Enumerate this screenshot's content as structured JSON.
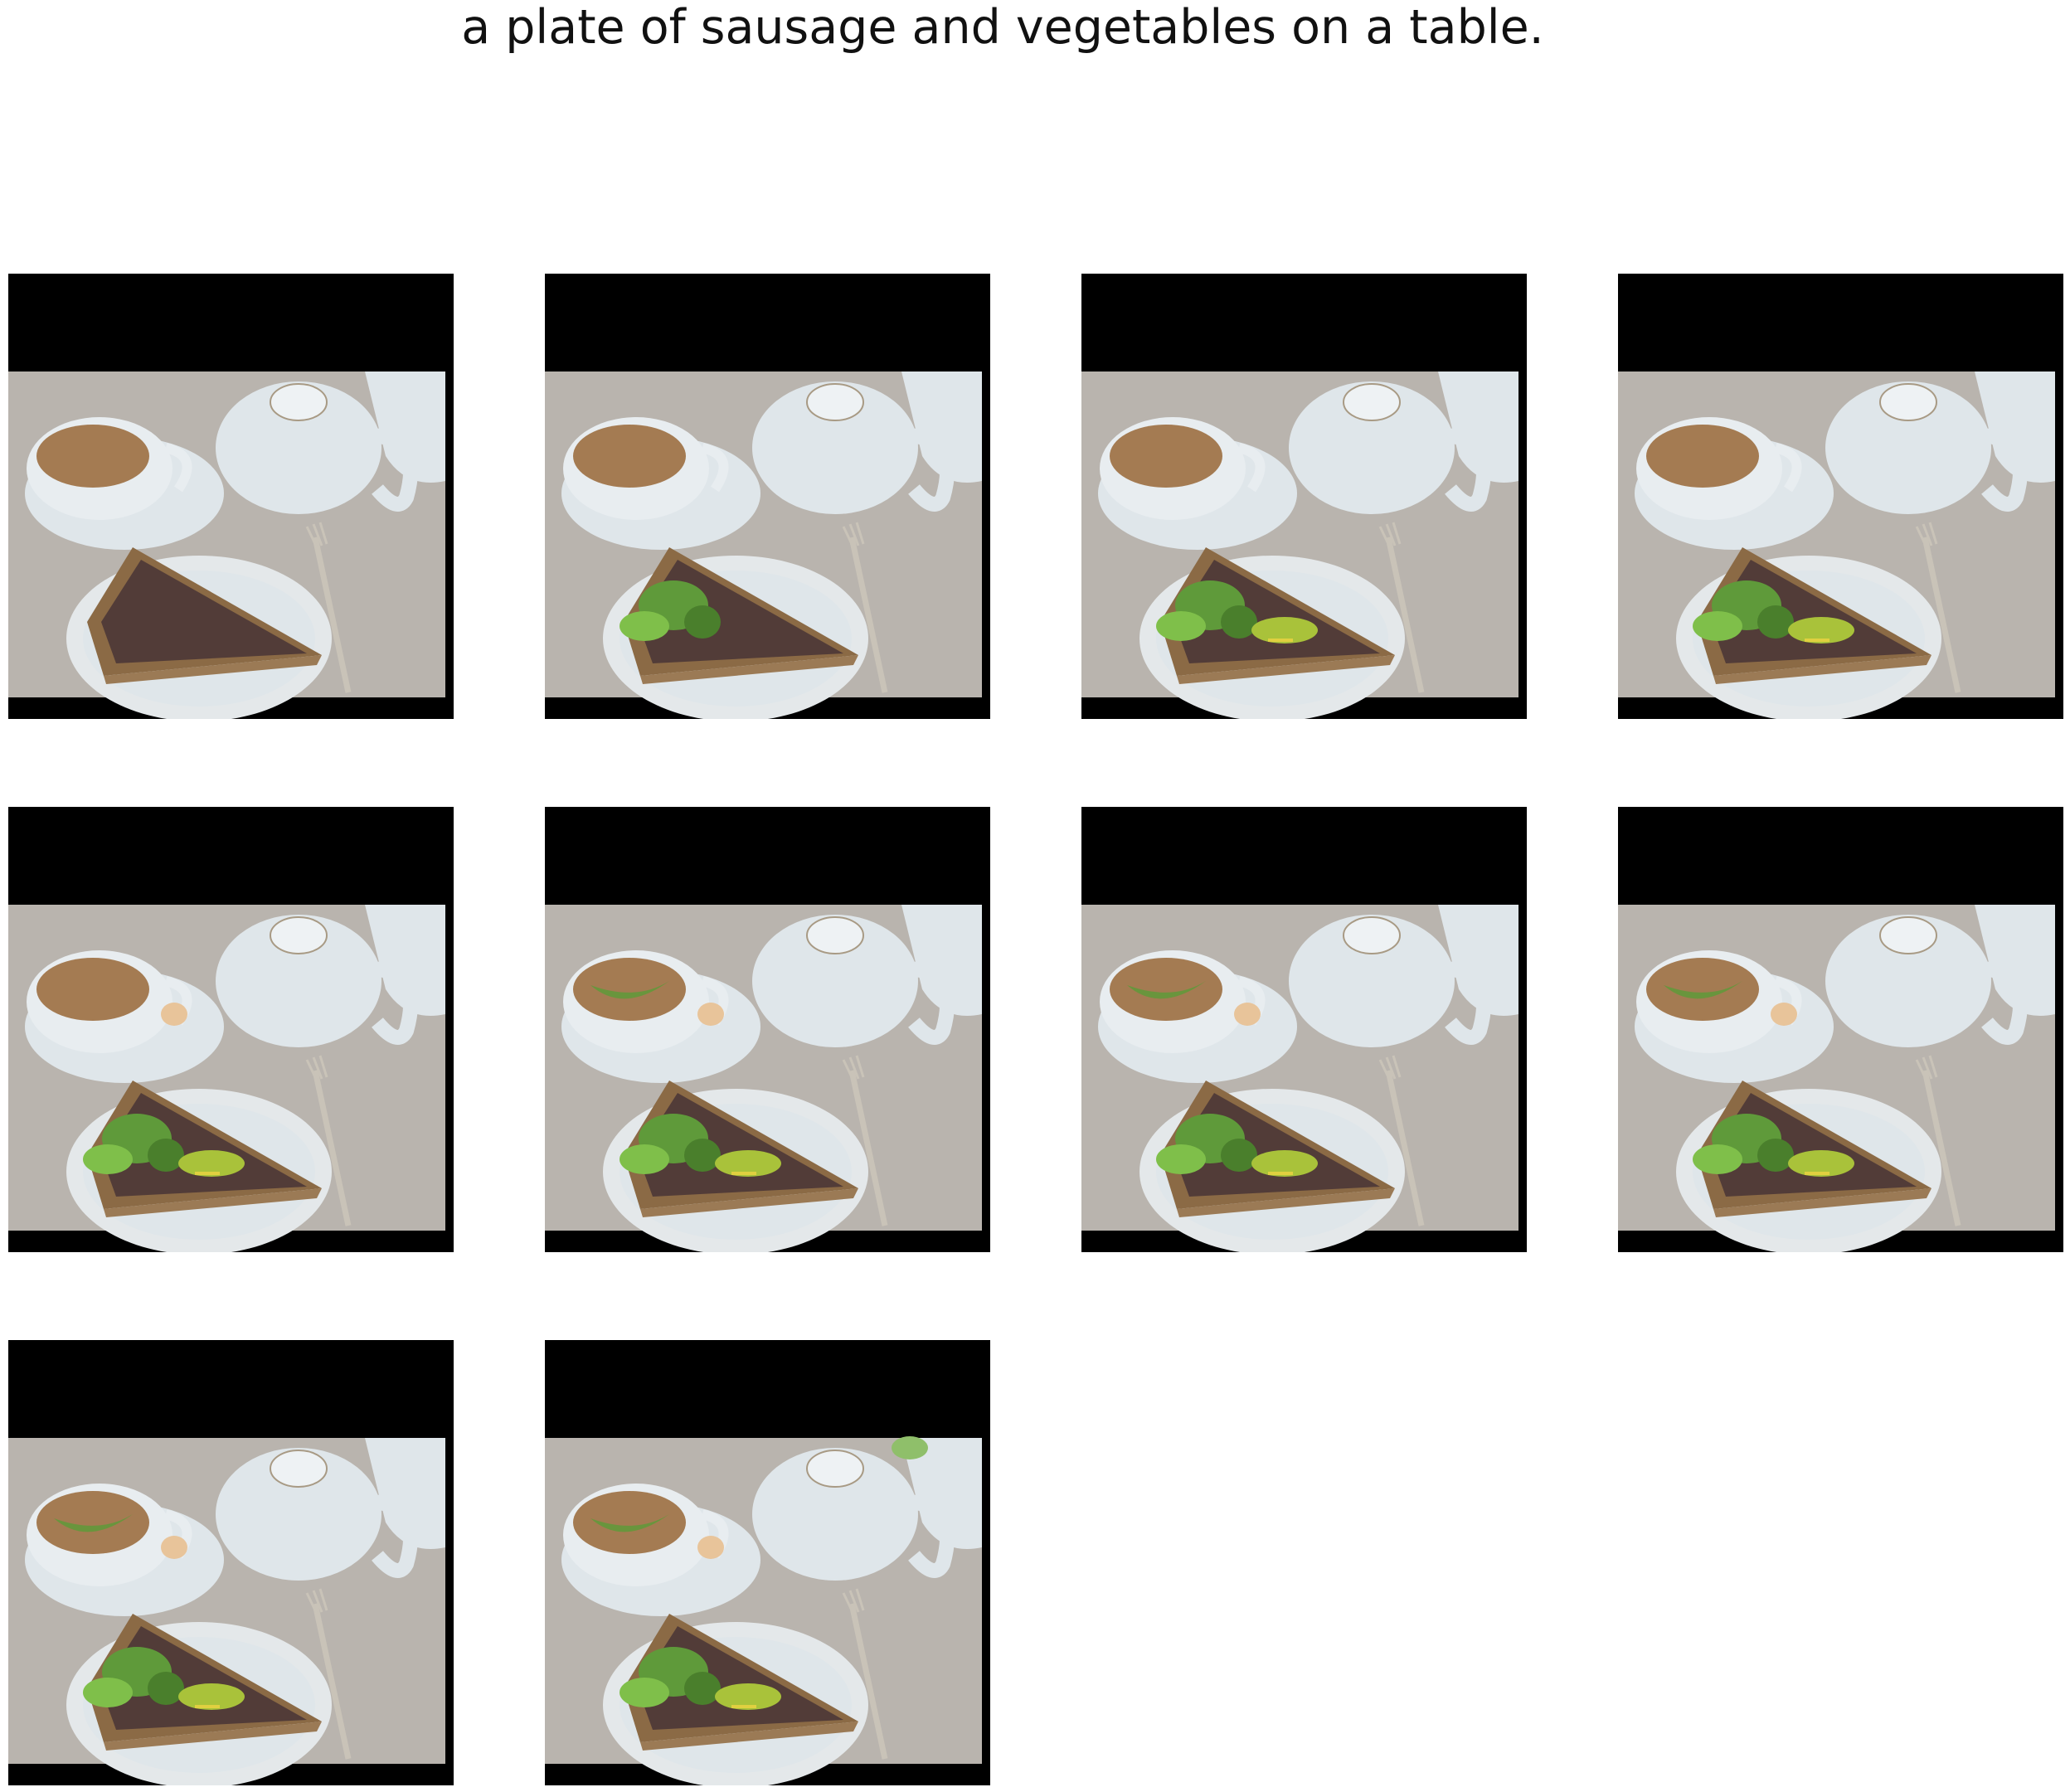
{
  "caption": "a plate of sausage and vegetables on a table.",
  "colors": {
    "background": "#ffffff",
    "letterbox": "#000000",
    "table": "#b9b4ae",
    "porcelain": "#dfe6ea",
    "tea": "#a47b52",
    "quiche_crust": "#8b6a45",
    "berries": "#3a2a33",
    "broccoli": "#5f9a3a",
    "avocado": "#a9c23a",
    "flower": "#e8c49a"
  },
  "grid": {
    "rows": 3,
    "columns": 4,
    "tile_count": 10
  },
  "tiles": [
    {
      "broccoli": false,
      "avocado": false,
      "cup_greens": false,
      "cup_flower": false,
      "pot_leaf": false
    },
    {
      "broccoli": true,
      "avocado": false,
      "cup_greens": false,
      "cup_flower": false,
      "pot_leaf": false
    },
    {
      "broccoli": true,
      "avocado": true,
      "cup_greens": false,
      "cup_flower": false,
      "pot_leaf": false
    },
    {
      "broccoli": true,
      "avocado": true,
      "cup_greens": false,
      "cup_flower": false,
      "pot_leaf": false
    },
    {
      "broccoli": true,
      "avocado": true,
      "cup_greens": false,
      "cup_flower": true,
      "pot_leaf": false
    },
    {
      "broccoli": true,
      "avocado": true,
      "cup_greens": true,
      "cup_flower": true,
      "pot_leaf": false
    },
    {
      "broccoli": true,
      "avocado": true,
      "cup_greens": true,
      "cup_flower": true,
      "pot_leaf": false
    },
    {
      "broccoli": true,
      "avocado": true,
      "cup_greens": true,
      "cup_flower": true,
      "pot_leaf": false
    },
    {
      "broccoli": true,
      "avocado": true,
      "cup_greens": true,
      "cup_flower": true,
      "pot_leaf": false
    },
    {
      "broccoli": true,
      "avocado": true,
      "cup_greens": true,
      "cup_flower": true,
      "pot_leaf": true
    }
  ]
}
